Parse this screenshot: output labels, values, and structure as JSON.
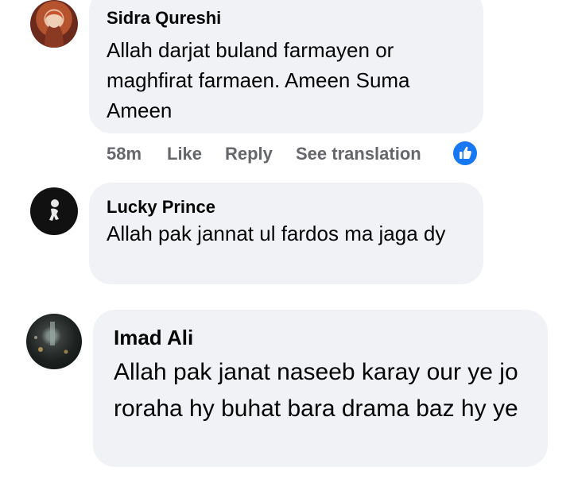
{
  "comments": [
    {
      "author": "Sidra Qureshi",
      "text": "Allah darjat buland farmayen or maghfirat farmaen. Ameen Suma Ameen",
      "avatar_icon": "user-avatar-photo",
      "time": "58m",
      "actions": {
        "like": "Like",
        "reply": "Reply",
        "see_translation": "See translation"
      },
      "reaction_icon": "thumbs-up-icon"
    },
    {
      "author": "Lucky Prince",
      "text": "Allah pak jannat ul fardos ma jaga dy",
      "avatar_icon": "user-avatar-logo"
    },
    {
      "author": "Imad Ali",
      "text": "Allah pak janat naseeb karay our ye jo roraha hy buhat bara drama baz hy ye",
      "avatar_icon": "user-avatar-photo"
    }
  ],
  "colors": {
    "bubble_bg": "#f0f2f5",
    "text": "#050505",
    "secondary_text": "#65676b",
    "like_blue": "#1877f2"
  }
}
